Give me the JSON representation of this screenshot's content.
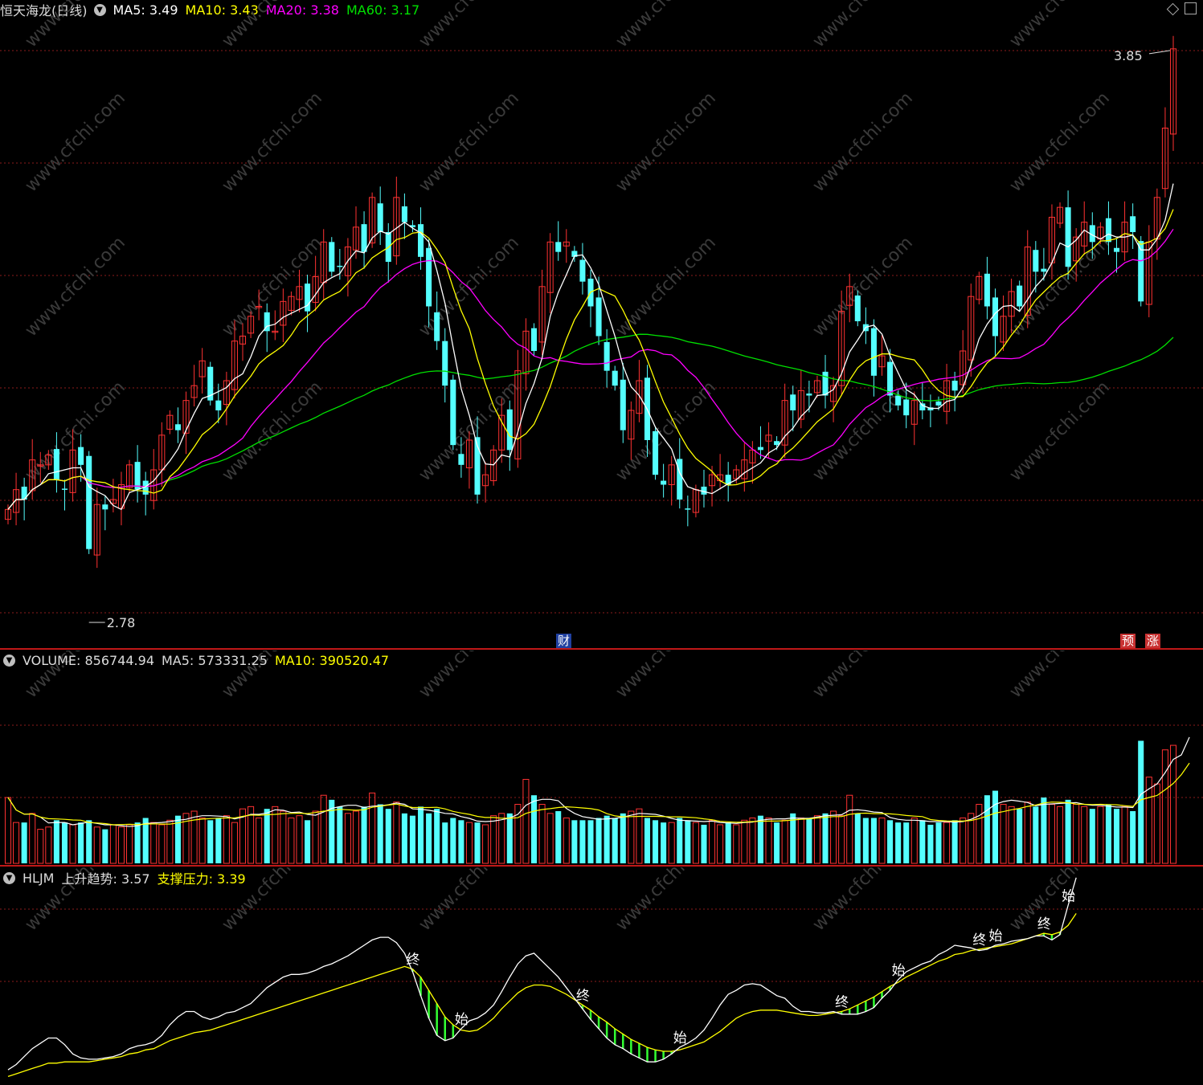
{
  "price_panel": {
    "title": "恒天海龙(日线)",
    "ma5_label": "MA5: 3.49",
    "ma10_label": "MA10: 3.43",
    "ma20_label": "MA20: 3.38",
    "ma60_label": "MA60: 3.17",
    "high_label": "3.85",
    "low_label": "2.78",
    "markers": {
      "cai": "财",
      "yu": "预",
      "zhang": "涨"
    }
  },
  "volume_panel": {
    "volume_label": "VOLUME: 856744.94",
    "ma5_label": "MA5: 573331.25",
    "ma10_label": "MA10: 390520.47"
  },
  "indicator_panel": {
    "name": "HLJM",
    "uptrend_label": "上升趋势: 3.57",
    "support_label": "支撑压力: 3.39",
    "signals": {
      "end": "终",
      "start": "始"
    }
  },
  "watermark": "www.cfchi.com",
  "colors": {
    "up": "#ff3232",
    "down": "#54ffff",
    "ma5": "#ffffff",
    "ma10": "#ffff00",
    "ma20": "#ff00ff",
    "ma60": "#00e000",
    "grid": "#8c1c1c",
    "divider": "#c01818",
    "hatch": "#33ff33"
  },
  "chart_data": [
    {
      "type": "candlestick",
      "title": "恒天海龙(日线)",
      "ylim": [
        2.7,
        3.9
      ],
      "close": [
        2.92,
        2.96,
        2.94,
        3.02,
        3.01,
        3.03,
        2.98,
        2.96,
        3.04,
        3.01,
        2.84,
        2.93,
        2.92,
        2.94,
        2.97,
        3.01,
        2.96,
        2.95,
        3.0,
        3.07,
        3.11,
        3.08,
        3.14,
        3.17,
        3.22,
        3.14,
        3.12,
        3.18,
        3.26,
        3.27,
        3.31,
        3.33,
        3.28,
        3.28,
        3.34,
        3.35,
        3.37,
        3.32,
        3.39,
        3.46,
        3.4,
        3.41,
        3.45,
        3.49,
        3.44,
        3.55,
        3.48,
        3.42,
        3.55,
        3.5,
        3.49,
        3.43,
        3.33,
        3.26,
        3.17,
        3.05,
        3.01,
        3.06,
        2.95,
        2.99,
        3.04,
        3.11,
        3.04,
        3.2,
        3.28,
        3.24,
        3.37,
        3.46,
        3.44,
        3.46,
        3.43,
        3.38,
        3.33,
        3.27,
        3.2,
        3.17,
        3.08,
        3.12,
        3.18,
        3.06,
        2.99,
        2.97,
        3.01,
        2.94,
        2.92,
        2.96,
        2.95,
        2.99,
        2.99,
        2.97,
        3.0,
        3.02,
        3.04,
        3.04,
        3.07,
        3.05,
        3.14,
        3.12,
        3.16,
        3.15,
        3.18,
        3.15,
        3.17,
        3.32,
        3.37,
        3.3,
        3.28,
        3.19,
        3.23,
        3.15,
        3.13,
        3.11,
        3.14,
        3.12,
        3.12,
        3.13,
        3.18,
        3.16,
        3.24,
        3.35,
        3.39,
        3.33,
        3.27,
        3.31,
        3.36,
        3.33,
        3.45,
        3.4,
        3.4,
        3.51,
        3.53,
        3.41,
        3.47,
        3.5,
        3.46,
        3.49,
        3.46,
        3.44,
        3.5,
        3.48,
        3.34,
        3.46,
        3.55,
        3.69,
        3.85
      ],
      "volume": [
        290,
        180,
        180,
        220,
        150,
        160,
        190,
        180,
        170,
        180,
        190,
        160,
        150,
        170,
        160,
        170,
        180,
        200,
        180,
        170,
        190,
        210,
        220,
        230,
        200,
        190,
        200,
        210,
        180,
        240,
        250,
        200,
        240,
        250,
        230,
        200,
        210,
        190,
        230,
        300,
        280,
        250,
        220,
        230,
        250,
        310,
        260,
        240,
        270,
        220,
        210,
        250,
        220,
        240,
        180,
        200,
        190,
        180,
        180,
        170,
        210,
        220,
        220,
        260,
        370,
        300,
        260,
        220,
        230,
        200,
        190,
        190,
        190,
        200,
        210,
        200,
        220,
        230,
        240,
        200,
        190,
        180,
        180,
        200,
        190,
        180,
        170,
        190,
        170,
        180,
        170,
        190,
        200,
        210,
        200,
        180,
        190,
        220,
        200,
        200,
        210,
        220,
        230,
        210,
        300,
        220,
        200,
        200,
        200,
        190,
        180,
        180,
        200,
        190,
        170,
        180,
        180,
        190,
        200,
        220,
        260,
        300,
        320,
        260,
        250,
        240,
        270,
        250,
        290,
        260,
        250,
        280,
        260,
        250,
        240,
        250,
        260,
        240,
        250,
        230,
        540,
        380,
        350,
        500,
        520,
        640,
        770
      ]
    },
    {
      "type": "line",
      "name": "HLJM",
      "ylim": [
        0,
        1
      ],
      "series": [
        {
          "name": "上升趋势",
          "values": [
            0.06,
            0.1,
            0.16,
            0.22,
            0.26,
            0.3,
            0.3,
            0.25,
            0.18,
            0.15,
            0.14,
            0.14,
            0.15,
            0.16,
            0.18,
            0.22,
            0.24,
            0.25,
            0.27,
            0.32,
            0.4,
            0.46,
            0.5,
            0.5,
            0.46,
            0.44,
            0.46,
            0.49,
            0.5,
            0.53,
            0.56,
            0.62,
            0.68,
            0.72,
            0.76,
            0.78,
            0.78,
            0.79,
            0.81,
            0.84,
            0.86,
            0.89,
            0.92,
            0.96,
            1.0,
            1.04,
            1.06,
            1.06,
            1.02,
            0.94,
            0.8,
            0.62,
            0.45,
            0.32,
            0.28,
            0.3,
            0.37,
            0.43,
            0.45,
            0.49,
            0.55,
            0.65,
            0.76,
            0.86,
            0.92,
            0.94,
            0.88,
            0.82,
            0.76,
            0.68,
            0.6,
            0.52,
            0.44,
            0.37,
            0.3,
            0.25,
            0.22,
            0.18,
            0.15,
            0.12,
            0.12,
            0.14,
            0.18,
            0.23,
            0.26,
            0.3,
            0.36,
            0.45,
            0.55,
            0.63,
            0.66,
            0.7,
            0.71,
            0.7,
            0.66,
            0.62,
            0.6,
            0.54,
            0.5,
            0.5,
            0.49,
            0.49,
            0.5,
            0.48,
            0.48,
            0.48,
            0.5,
            0.53,
            0.6,
            0.66,
            0.74,
            0.8,
            0.83,
            0.86,
            0.88,
            0.93,
            0.96,
            1.0,
            0.99,
            0.98,
            0.96,
            0.97,
            1.0,
            1.01,
            1.03,
            1.04,
            1.05,
            1.07,
            1.07,
            1.04,
            1.08,
            1.3,
            1.51
          ]
        },
        {
          "name": "支撑压力",
          "values": [
            0.01,
            0.03,
            0.05,
            0.07,
            0.09,
            0.11,
            0.11,
            0.12,
            0.12,
            0.12,
            0.12,
            0.13,
            0.14,
            0.15,
            0.16,
            0.18,
            0.19,
            0.21,
            0.22,
            0.25,
            0.28,
            0.3,
            0.32,
            0.34,
            0.35,
            0.36,
            0.38,
            0.4,
            0.42,
            0.44,
            0.46,
            0.48,
            0.5,
            0.52,
            0.54,
            0.56,
            0.58,
            0.6,
            0.62,
            0.64,
            0.66,
            0.68,
            0.7,
            0.72,
            0.74,
            0.76,
            0.78,
            0.8,
            0.82,
            0.84,
            0.82,
            0.76,
            0.66,
            0.56,
            0.46,
            0.4,
            0.36,
            0.35,
            0.36,
            0.4,
            0.45,
            0.52,
            0.58,
            0.64,
            0.68,
            0.7,
            0.7,
            0.69,
            0.66,
            0.63,
            0.59,
            0.55,
            0.51,
            0.46,
            0.42,
            0.37,
            0.33,
            0.29,
            0.26,
            0.23,
            0.21,
            0.2,
            0.2,
            0.21,
            0.23,
            0.25,
            0.27,
            0.31,
            0.35,
            0.4,
            0.45,
            0.48,
            0.5,
            0.51,
            0.51,
            0.51,
            0.5,
            0.49,
            0.48,
            0.47,
            0.47,
            0.48,
            0.49,
            0.5,
            0.52,
            0.55,
            0.58,
            0.61,
            0.65,
            0.69,
            0.72,
            0.76,
            0.79,
            0.82,
            0.85,
            0.88,
            0.9,
            0.93,
            0.94,
            0.96,
            0.97,
            0.98,
            0.99,
            1.0,
            1.01,
            1.03,
            1.05,
            1.07,
            1.09,
            1.08,
            1.1,
            1.15,
            1.24
          ]
        }
      ]
    }
  ]
}
